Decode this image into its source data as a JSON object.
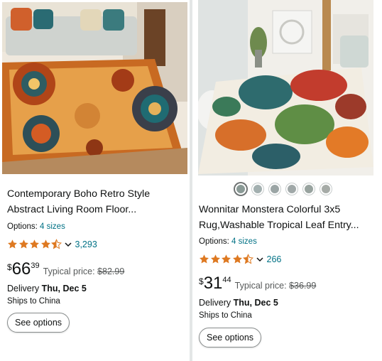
{
  "products": [
    {
      "title_line1": "Contemporary Boho Retro Style",
      "title_line2": "Abstract Living Room Floor...",
      "options_label": "Options:",
      "options_link": "4 sizes",
      "rating": 4.5,
      "rating_count": "3,293",
      "price_symbol": "$",
      "price_whole": "66",
      "price_fraction": "39",
      "typical_label": "Typical price:",
      "typical_price": "$82.99",
      "delivery_label": "Delivery",
      "delivery_date": "Thu, Dec 5",
      "ships_to": "Ships to China",
      "button_label": "See options"
    },
    {
      "title_line1": "Wonnitar Monstera Colorful 3x5",
      "title_line2": "Rug,Washable Tropical Leaf Entry...",
      "options_label": "Options:",
      "options_link": "4 sizes",
      "rating": 4.5,
      "rating_count": "266",
      "price_symbol": "$",
      "price_whole": "31",
      "price_fraction": "44",
      "typical_label": "Typical price:",
      "typical_price": "$36.99",
      "delivery_label": "Delivery",
      "delivery_date": "Thu, Dec 5",
      "ships_to": "Ships to China",
      "button_label": "See options",
      "swatch_colors": [
        "#8a9a96",
        "#a3b0b0",
        "#9ba5a5",
        "#a0a8a8",
        "#98a39f",
        "#a6aba7"
      ]
    }
  ],
  "colors": {
    "star": "#de7921",
    "link": "#007185",
    "background": "#e3e6e6"
  }
}
